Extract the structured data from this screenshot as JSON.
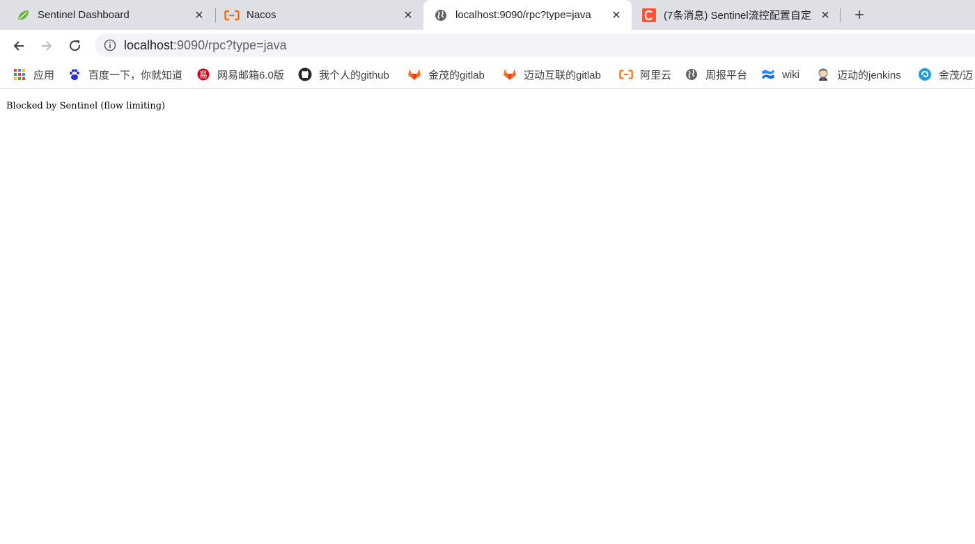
{
  "tabs": [
    {
      "title": "Sentinel Dashboard",
      "close": "✕",
      "active": false
    },
    {
      "title": "Nacos",
      "close": "✕",
      "active": false
    },
    {
      "title": "localhost:9090/rpc?type=java",
      "close": "✕",
      "active": true
    },
    {
      "title": "(7条消息) Sentinel流控配置自定",
      "close": "✕",
      "active": false
    }
  ],
  "newtab": "+",
  "address": {
    "host": "localhost",
    "rest": ":9090/rpc?type=java"
  },
  "bookmarks": [
    {
      "label": "应用",
      "icon": "apps-grid-icon"
    },
    {
      "label": "百度一下，你就知道",
      "icon": "baidu-paw-icon"
    },
    {
      "label": "网易邮箱6.0版",
      "icon": "netease-mail-icon"
    },
    {
      "label": "我个人的github",
      "icon": "github-icon"
    },
    {
      "label": "金茂的gitlab",
      "icon": "gitlab-icon"
    },
    {
      "label": "迈动互联的gitlab",
      "icon": "gitlab-icon"
    },
    {
      "label": "阿里云",
      "icon": "aliyun-icon"
    },
    {
      "label": "周报平台",
      "icon": "globe-icon"
    },
    {
      "label": "wiki",
      "icon": "confluence-icon"
    },
    {
      "label": "迈动的jenkins",
      "icon": "jenkins-icon"
    },
    {
      "label": "金茂/迈",
      "icon": "swirl-icon"
    }
  ],
  "page": {
    "text": "Blocked by Sentinel (flow limiting)"
  }
}
